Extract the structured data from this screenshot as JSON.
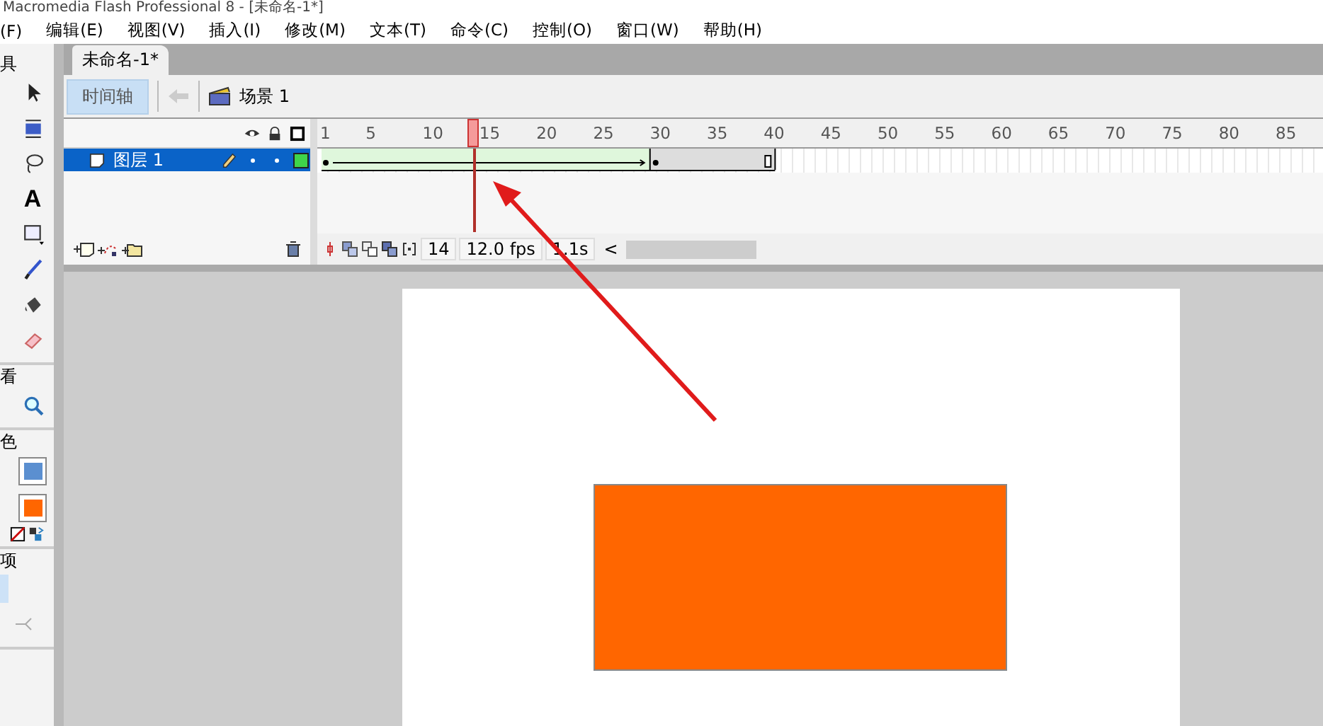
{
  "window": {
    "title": "Macromedia Flash Professional 8 - [未命名-1*]"
  },
  "menu": [
    "(F)",
    "编辑(E)",
    "视图(V)",
    "插入(I)",
    "修改(M)",
    "文本(T)",
    "命令(C)",
    "控制(O)",
    "窗口(W)",
    "帮助(H)"
  ],
  "toolbox": {
    "sections": [
      "具",
      "看",
      "色",
      "项"
    ],
    "text_tool": "A",
    "swatches": [
      {
        "color": "#5b8fd0"
      },
      {
        "color": "#ff6600"
      }
    ]
  },
  "document_tab": {
    "label": "未命名-1*",
    "selected": true
  },
  "timeline": {
    "toggle": {
      "label": "时间轴",
      "selected": true
    },
    "scene": "场景 1",
    "layers": [
      {
        "name": "图层 1",
        "selected": true
      }
    ],
    "ruler": [
      "1",
      "5",
      "10",
      "15",
      "20",
      "25",
      "30",
      "35",
      "40",
      "45",
      "50",
      "55",
      "60",
      "65",
      "70",
      "75",
      "80",
      "85"
    ],
    "current_frame": "14",
    "fps": "12.0 fps",
    "elapsed": "1.1s",
    "scroll_arrow": "<"
  }
}
